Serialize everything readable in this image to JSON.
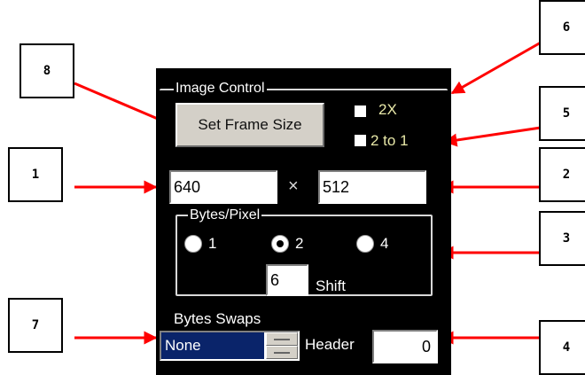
{
  "callouts": [
    "8",
    "6",
    "5",
    "1",
    "2",
    "3",
    "7",
    "4"
  ],
  "panel": {
    "group_title": "Image Control",
    "set_frame_size_button": "Set Frame Size",
    "checkbox_2x_label": "2X",
    "checkbox_2to1_label": "2 to 1",
    "width_value": "640",
    "times_symbol": "×",
    "height_value": "512",
    "bytes_per_pixel": {
      "title": "Bytes/Pixel",
      "options": [
        "1",
        "2",
        "4"
      ],
      "selected": "2",
      "shift_value": "6",
      "shift_label": "Shift"
    },
    "byte_swaps_label": "Bytes Swaps",
    "byte_swaps_value": "None",
    "header_label": "Header",
    "header_value": "0"
  },
  "colors": {
    "arrow": "#ff0000",
    "panel_bg": "#000000",
    "selection": "#0a246a"
  }
}
